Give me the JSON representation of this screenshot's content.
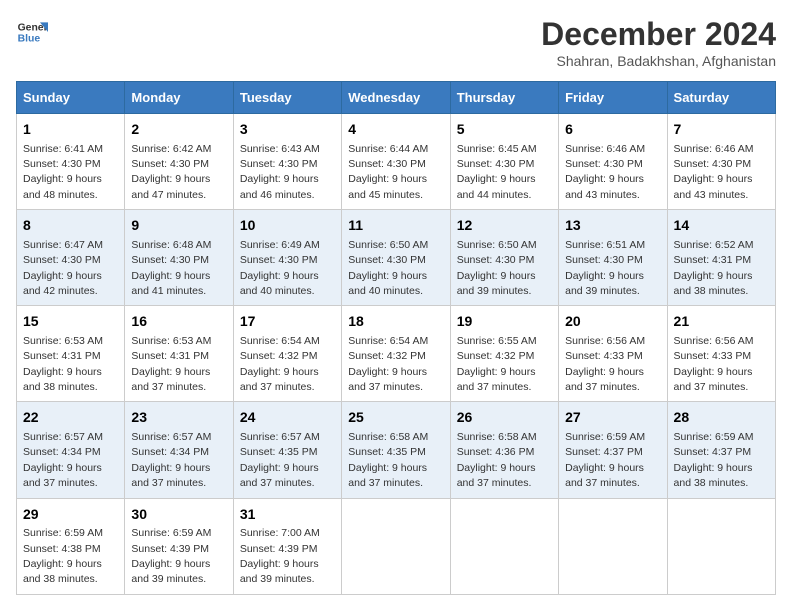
{
  "header": {
    "logo_line1": "General",
    "logo_line2": "Blue",
    "title": "December 2024",
    "subtitle": "Shahran, Badakhshan, Afghanistan"
  },
  "days_of_week": [
    "Sunday",
    "Monday",
    "Tuesday",
    "Wednesday",
    "Thursday",
    "Friday",
    "Saturday"
  ],
  "weeks": [
    [
      {
        "day": "1",
        "info": "Sunrise: 6:41 AM\nSunset: 4:30 PM\nDaylight: 9 hours\nand 48 minutes."
      },
      {
        "day": "2",
        "info": "Sunrise: 6:42 AM\nSunset: 4:30 PM\nDaylight: 9 hours\nand 47 minutes."
      },
      {
        "day": "3",
        "info": "Sunrise: 6:43 AM\nSunset: 4:30 PM\nDaylight: 9 hours\nand 46 minutes."
      },
      {
        "day": "4",
        "info": "Sunrise: 6:44 AM\nSunset: 4:30 PM\nDaylight: 9 hours\nand 45 minutes."
      },
      {
        "day": "5",
        "info": "Sunrise: 6:45 AM\nSunset: 4:30 PM\nDaylight: 9 hours\nand 44 minutes."
      },
      {
        "day": "6",
        "info": "Sunrise: 6:46 AM\nSunset: 4:30 PM\nDaylight: 9 hours\nand 43 minutes."
      },
      {
        "day": "7",
        "info": "Sunrise: 6:46 AM\nSunset: 4:30 PM\nDaylight: 9 hours\nand 43 minutes."
      }
    ],
    [
      {
        "day": "8",
        "info": "Sunrise: 6:47 AM\nSunset: 4:30 PM\nDaylight: 9 hours\nand 42 minutes."
      },
      {
        "day": "9",
        "info": "Sunrise: 6:48 AM\nSunset: 4:30 PM\nDaylight: 9 hours\nand 41 minutes."
      },
      {
        "day": "10",
        "info": "Sunrise: 6:49 AM\nSunset: 4:30 PM\nDaylight: 9 hours\nand 40 minutes."
      },
      {
        "day": "11",
        "info": "Sunrise: 6:50 AM\nSunset: 4:30 PM\nDaylight: 9 hours\nand 40 minutes."
      },
      {
        "day": "12",
        "info": "Sunrise: 6:50 AM\nSunset: 4:30 PM\nDaylight: 9 hours\nand 39 minutes."
      },
      {
        "day": "13",
        "info": "Sunrise: 6:51 AM\nSunset: 4:30 PM\nDaylight: 9 hours\nand 39 minutes."
      },
      {
        "day": "14",
        "info": "Sunrise: 6:52 AM\nSunset: 4:31 PM\nDaylight: 9 hours\nand 38 minutes."
      }
    ],
    [
      {
        "day": "15",
        "info": "Sunrise: 6:53 AM\nSunset: 4:31 PM\nDaylight: 9 hours\nand 38 minutes."
      },
      {
        "day": "16",
        "info": "Sunrise: 6:53 AM\nSunset: 4:31 PM\nDaylight: 9 hours\nand 37 minutes."
      },
      {
        "day": "17",
        "info": "Sunrise: 6:54 AM\nSunset: 4:32 PM\nDaylight: 9 hours\nand 37 minutes."
      },
      {
        "day": "18",
        "info": "Sunrise: 6:54 AM\nSunset: 4:32 PM\nDaylight: 9 hours\nand 37 minutes."
      },
      {
        "day": "19",
        "info": "Sunrise: 6:55 AM\nSunset: 4:32 PM\nDaylight: 9 hours\nand 37 minutes."
      },
      {
        "day": "20",
        "info": "Sunrise: 6:56 AM\nSunset: 4:33 PM\nDaylight: 9 hours\nand 37 minutes."
      },
      {
        "day": "21",
        "info": "Sunrise: 6:56 AM\nSunset: 4:33 PM\nDaylight: 9 hours\nand 37 minutes."
      }
    ],
    [
      {
        "day": "22",
        "info": "Sunrise: 6:57 AM\nSunset: 4:34 PM\nDaylight: 9 hours\nand 37 minutes."
      },
      {
        "day": "23",
        "info": "Sunrise: 6:57 AM\nSunset: 4:34 PM\nDaylight: 9 hours\nand 37 minutes."
      },
      {
        "day": "24",
        "info": "Sunrise: 6:57 AM\nSunset: 4:35 PM\nDaylight: 9 hours\nand 37 minutes."
      },
      {
        "day": "25",
        "info": "Sunrise: 6:58 AM\nSunset: 4:35 PM\nDaylight: 9 hours\nand 37 minutes."
      },
      {
        "day": "26",
        "info": "Sunrise: 6:58 AM\nSunset: 4:36 PM\nDaylight: 9 hours\nand 37 minutes."
      },
      {
        "day": "27",
        "info": "Sunrise: 6:59 AM\nSunset: 4:37 PM\nDaylight: 9 hours\nand 37 minutes."
      },
      {
        "day": "28",
        "info": "Sunrise: 6:59 AM\nSunset: 4:37 PM\nDaylight: 9 hours\nand 38 minutes."
      }
    ],
    [
      {
        "day": "29",
        "info": "Sunrise: 6:59 AM\nSunset: 4:38 PM\nDaylight: 9 hours\nand 38 minutes."
      },
      {
        "day": "30",
        "info": "Sunrise: 6:59 AM\nSunset: 4:39 PM\nDaylight: 9 hours\nand 39 minutes."
      },
      {
        "day": "31",
        "info": "Sunrise: 7:00 AM\nSunset: 4:39 PM\nDaylight: 9 hours\nand 39 minutes."
      },
      {
        "day": "",
        "info": ""
      },
      {
        "day": "",
        "info": ""
      },
      {
        "day": "",
        "info": ""
      },
      {
        "day": "",
        "info": ""
      }
    ]
  ]
}
